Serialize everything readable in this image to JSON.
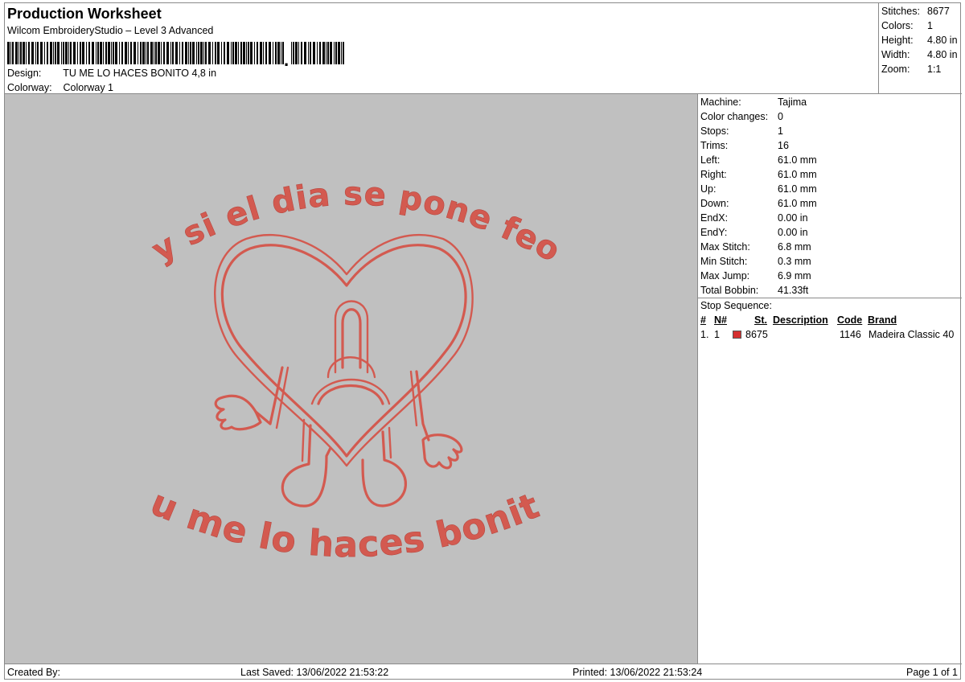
{
  "header": {
    "title": "Production Worksheet",
    "subtitle": "Wilcom EmbroideryStudio – Level 3 Advanced",
    "design_label": "Design:",
    "design_value": "TU ME LO HACES BONITO 4,8 in",
    "colorway_label": "Colorway:",
    "colorway_value": "Colorway 1"
  },
  "summary": {
    "stitches_label": "Stitches:",
    "stitches_value": "8677",
    "colors_label": "Colors:",
    "colors_value": "1",
    "height_label": "Height:",
    "height_value": "4.80 in",
    "width_label": "Width:",
    "width_value": "4.80 in",
    "zoom_label": "Zoom:",
    "zoom_value": "1:1"
  },
  "specs": [
    {
      "k": "Machine:",
      "v": "Tajima"
    },
    {
      "k": "Color changes:",
      "v": "0"
    },
    {
      "k": "Stops:",
      "v": "1"
    },
    {
      "k": "Trims:",
      "v": "16"
    },
    {
      "k": "Left:",
      "v": "61.0 mm"
    },
    {
      "k": "Right:",
      "v": "61.0 mm"
    },
    {
      "k": "Up:",
      "v": "61.0 mm"
    },
    {
      "k": "Down:",
      "v": "61.0 mm"
    },
    {
      "k": "EndX:",
      "v": "0.00 in"
    },
    {
      "k": "EndY:",
      "v": "0.00 in"
    },
    {
      "k": "Max Stitch:",
      "v": "6.8 mm"
    },
    {
      "k": "Min Stitch:",
      "v": "0.3 mm"
    },
    {
      "k": "Max Jump:",
      "v": "6.9 mm"
    },
    {
      "k": "Total Bobbin:",
      "v": "41.33ft"
    }
  ],
  "stop_sequence": {
    "caption": "Stop Sequence:",
    "columns": [
      "#",
      "N#",
      "St.",
      "Description",
      "Code",
      "Brand"
    ],
    "rows": [
      {
        "index": "1.",
        "n": "1",
        "stitches": "8675",
        "description": "",
        "code": "1146",
        "brand": "Madeira Classic 40",
        "color": "#d42f2f"
      }
    ]
  },
  "design": {
    "top_text": "y si el dia se pone feo",
    "bottom_text": "tu me lo haces bonito",
    "thread_color": "#d35a50",
    "background_color": "#c0c0c0"
  },
  "footer": {
    "created_by": "Created By:",
    "last_saved": "Last Saved: 13/06/2022 21:53:22",
    "printed": "Printed: 13/06/2022 21:53:24",
    "page": "Page 1 of 1"
  }
}
